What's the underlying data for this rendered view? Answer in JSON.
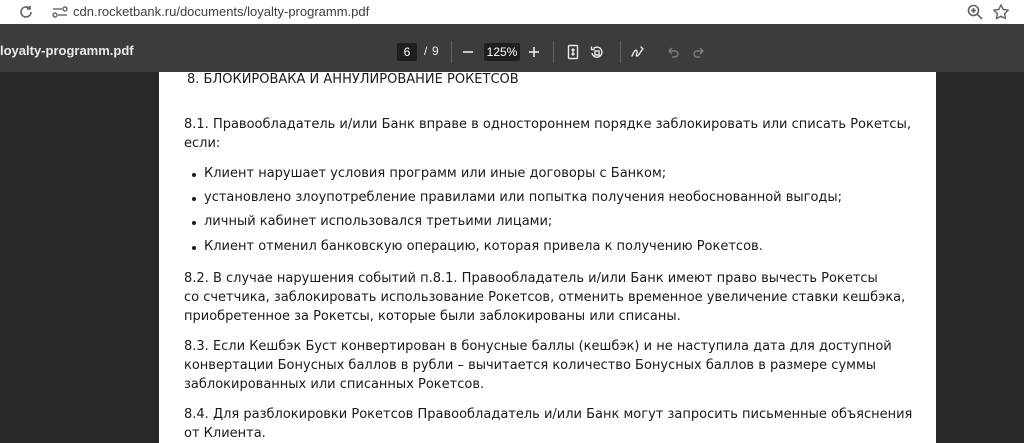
{
  "browser": {
    "url": "cdn.rocketbank.ru/documents/loyalty-programm.pdf"
  },
  "pdf_toolbar": {
    "title": "loyalty-programm.pdf",
    "current_page": "6",
    "separator": "/",
    "total_pages": "9",
    "zoom": "125%"
  },
  "document": {
    "heading": "8. БЛОКИРОВАКА И АННУЛИРОВАНИЕ РОКЕТСОВ",
    "p1": [
      "8.1. Правообладатель и/или Банк вправе в одностороннем порядке заблокировать или списать Рокетсы,",
      "если:"
    ],
    "bullets": [
      "Клиент нарушает условия программ или иные договоры с Банком;",
      "установлено злоупотребление правилами или попытка получения необоснованной выгоды;",
      "личный кабинет использовался третьими лицами;",
      "Клиент отменил банковскую операцию, которая привела к получению Рокетсов."
    ],
    "p2": [
      "8.2. В случае нарушения событий п.8.1. Правообладатель и/или Банк имеют право вычесть Рокетсы",
      "со счетчика, заблокировать использование Рокетсов, отменить временное увеличение ставки кешбэка,",
      "приобретенное за Рокетсы, которые были заблокированы или списаны."
    ],
    "p3": [
      "8.3. Если Кешбэк Буст конвертирован в бонусные баллы (кешбэк) и не наступила дата для доступной",
      "конвертации Бонусных баллов в рубли – вычитается количество Бонусных баллов в размере суммы",
      "заблокированных или списанных Рокетсов."
    ],
    "p4": [
      "8.4. Для разблокировки Рокетсов Правообладатель и/или Банк могут запросить письменные объяснения",
      "от Клиента."
    ]
  }
}
